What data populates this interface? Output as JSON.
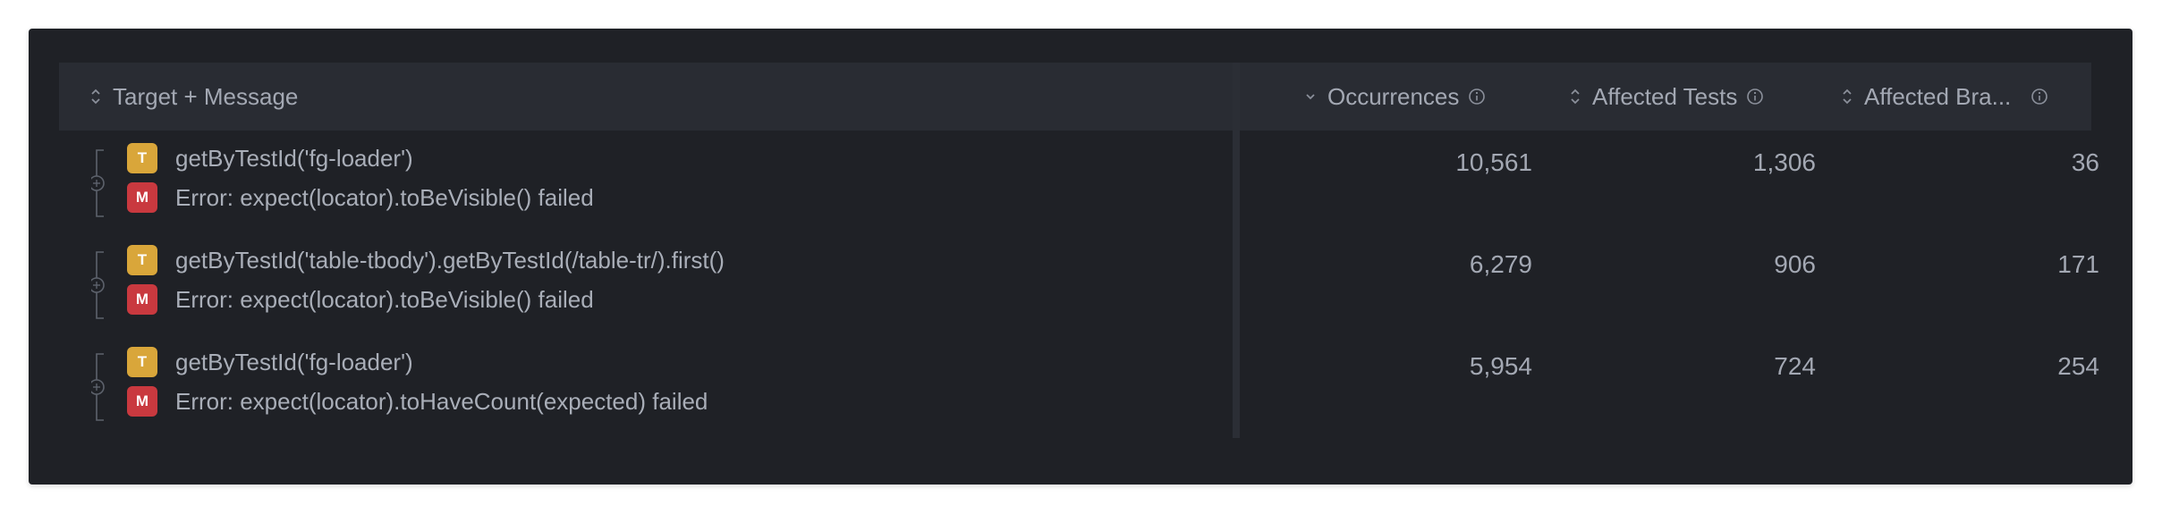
{
  "table": {
    "columns": {
      "target_message": "Target + Message",
      "occurrences": "Occurrences",
      "affected_tests": "Affected Tests",
      "affected_branches": "Affected Bra..."
    },
    "rows": [
      {
        "target_badge": "T",
        "target": "getByTestId('fg-loader')",
        "message_badge": "M",
        "message": "Error: expect(locator).toBeVisible() failed",
        "occurrences": "10,561",
        "affected_tests": "1,306",
        "affected_branches": "36"
      },
      {
        "target_badge": "T",
        "target": "getByTestId('table-tbody').getByTestId(/table-tr/).first()",
        "message_badge": "M",
        "message": "Error: expect(locator).toBeVisible() failed",
        "occurrences": "6,279",
        "affected_tests": "906",
        "affected_branches": "171"
      },
      {
        "target_badge": "T",
        "target": "getByTestId('fg-loader')",
        "message_badge": "M",
        "message": "Error: expect(locator).toHaveCount(expected) failed",
        "occurrences": "5,954",
        "affected_tests": "724",
        "affected_branches": "254"
      }
    ]
  },
  "icons": {
    "sort": "sort-updown-icon",
    "sort_active": "chevron-down-icon",
    "info": "info-circle-icon",
    "expand": "plus-circle-icon"
  },
  "colors": {
    "panel_bg": "#1f2126",
    "header_bg": "#292c33",
    "text": "#a3a8b3",
    "target_badge": "#d9a63a",
    "message_badge": "#c9393f"
  }
}
